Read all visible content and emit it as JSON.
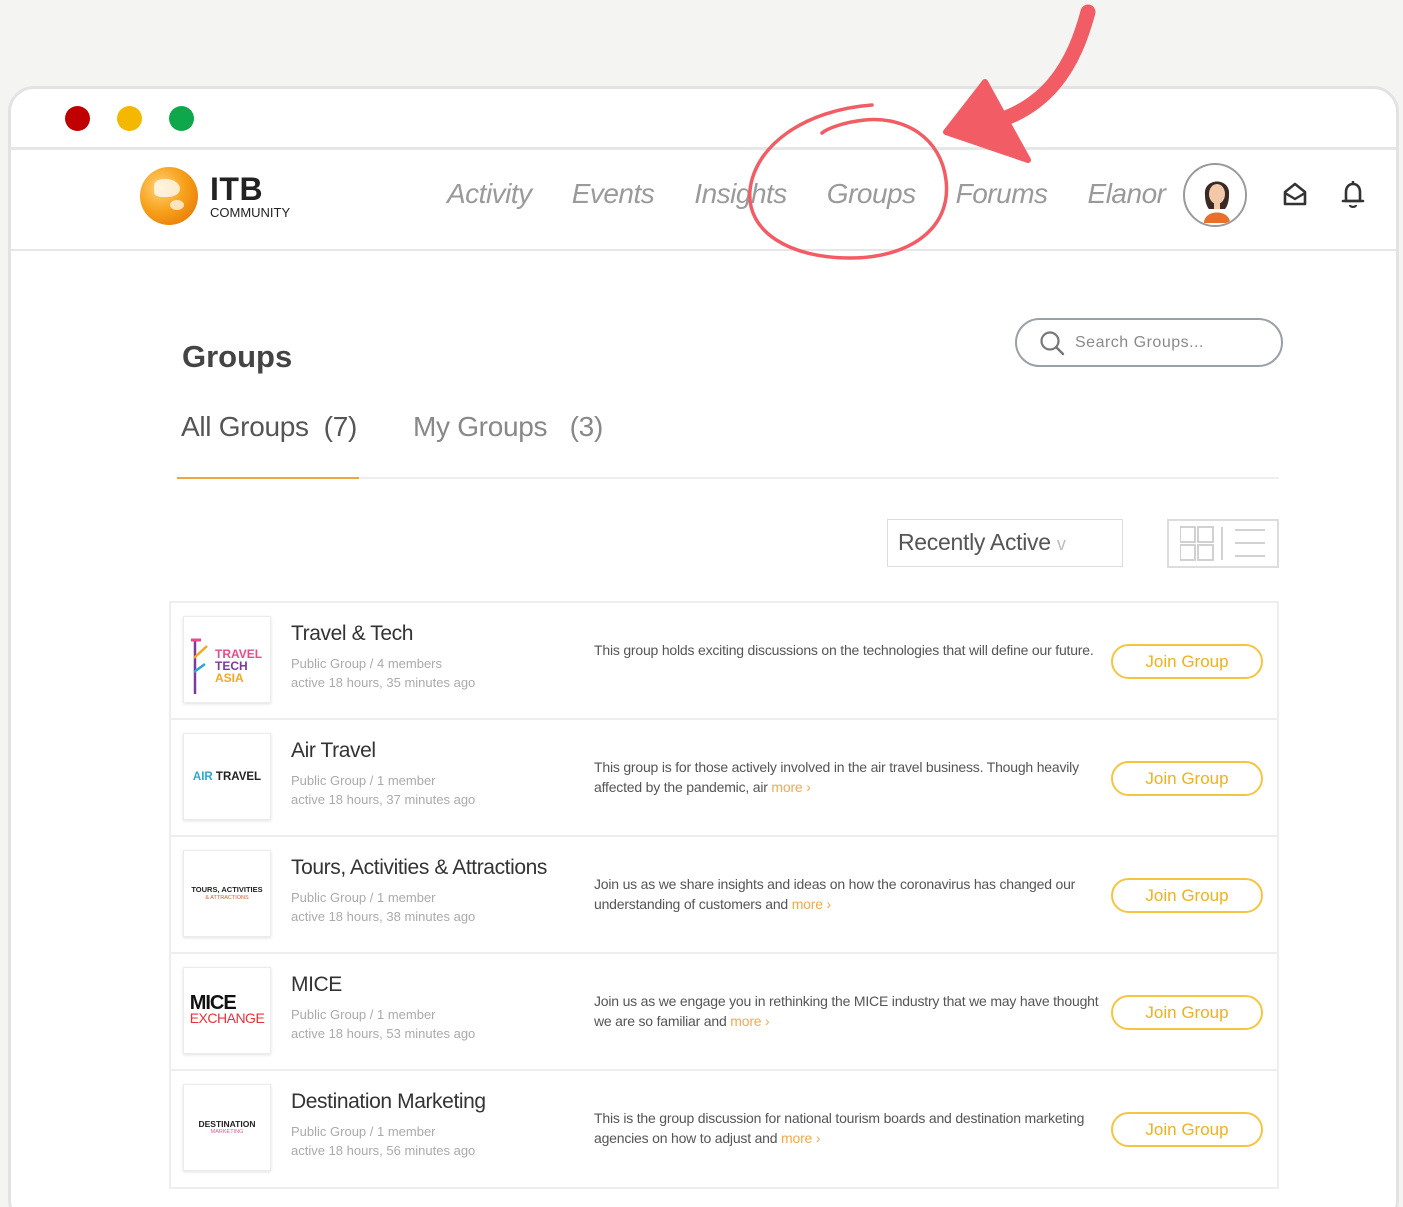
{
  "brand": {
    "title": "ITB",
    "subtitle": "COMMUNITY"
  },
  "nav": {
    "links": [
      "Activity",
      "Events",
      "Insights",
      "Groups",
      "Forums",
      "Elanor"
    ]
  },
  "page": {
    "title": "Groups"
  },
  "search": {
    "placeholder": "Search Groups..."
  },
  "tabs": {
    "all": "All Groups  (7)",
    "mine": "My Groups   (3)"
  },
  "sort": {
    "selected": "Recently Active",
    "chevron": "v"
  },
  "more_label": "more ›",
  "join_label": "Join Group",
  "groups": [
    {
      "name": "Travel & Tech",
      "meta": "Public Group / 4 members",
      "active": "active 18 hours, 35 minutes ago",
      "description": "This group holds exciting discussions on the technologies that will define our future.",
      "logo": [
        "TRAVEL",
        "TECH",
        "ASIA"
      ]
    },
    {
      "name": "Air Travel",
      "meta": "Public Group / 1 member",
      "active": "active 18 hours, 37 minutes ago",
      "description": "This group is for those actively involved in the air travel business. Though heavily affected by the pandemic, air",
      "logo": [
        "AIR",
        "TRAVEL"
      ]
    },
    {
      "name": "Tours, Activities & Attractions",
      "meta": "Public Group / 1 member",
      "active": "active 18 hours, 38 minutes ago",
      "description": "Join us as we share insights and ideas on how the coronavirus has changed our understanding of customers and",
      "logo": [
        "TOURS, ACTIVITIES",
        "& ATTRACTIONS"
      ]
    },
    {
      "name": "MICE",
      "meta": "Public Group / 1 member",
      "active": "active 18 hours, 53 minutes ago",
      "description": "Join us as we engage you in rethinking the MICE industry that we may have thought we are so familiar and",
      "logo": [
        "MICE",
        "EXCHANGE"
      ]
    },
    {
      "name": "Destination Marketing",
      "meta": "Public Group / 1 member",
      "active": "active 18 hours, 56 minutes ago",
      "description": "This is the group discussion for national tourism boards and destination marketing agencies on how to adjust and",
      "logo": [
        "DESTINATION",
        "MARKETING"
      ]
    }
  ],
  "colors": {
    "accent": "#f0a640",
    "join": "#f5c542",
    "annotation": "#f25c64",
    "traffic_red": "#c00000",
    "traffic_yellow": "#f5b800",
    "traffic_green": "#0ea84a"
  }
}
